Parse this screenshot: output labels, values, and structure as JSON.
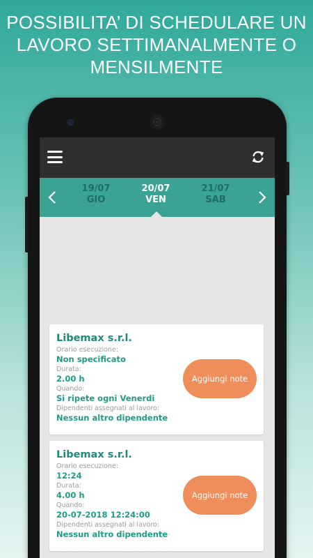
{
  "headline": {
    "line1": "POSSIBILITA’ DI SCHEDULARE UN",
    "line2": "LAVORO SETTIMANALMENTE O",
    "line3": "MENSILMENTE"
  },
  "appbar": {
    "menu_icon": "hamburger-menu-icon",
    "refresh_icon": "refresh-icon"
  },
  "datebar": {
    "color": "#3aa394",
    "days": [
      {
        "date": "19/07",
        "name": "GIO"
      },
      {
        "date": "20/07",
        "name": "VEN"
      },
      {
        "date": "21/07",
        "name": "SAB"
      }
    ],
    "prev_icon": "chevron-left-icon",
    "next_icon": "chevron-right-icon"
  },
  "jobs": [
    {
      "company": "Libemax s.r.l.",
      "time_label": "Orario esecuzione:",
      "time_value": "Non specificato",
      "duration_label": "Durata:",
      "duration_value": "2.00 h",
      "when_label": "Quando:",
      "when_value": "Si ripete ogni Venerdi",
      "employees_label": "Dipendenti assegnati al lavoro:",
      "employees_value": "Nessun altro dipendente",
      "button": "Aggiungi note"
    },
    {
      "company": "Libemax s.r.l.",
      "time_label": "Orario esecuzione:",
      "time_value": "12:24",
      "duration_label": "Durata:",
      "duration_value": "4.00 h",
      "when_label": "Quando:",
      "when_value": "20-07-2018 12:24:00",
      "employees_label": "Dipendenti assegnati al lavoro:",
      "employees_value": "Nessun altro dipendente",
      "button": "Aggiungi note"
    }
  ],
  "colors": {
    "accent": "#1f9a88",
    "button": "#ef8e5a",
    "appbar": "#2f2f2f"
  }
}
